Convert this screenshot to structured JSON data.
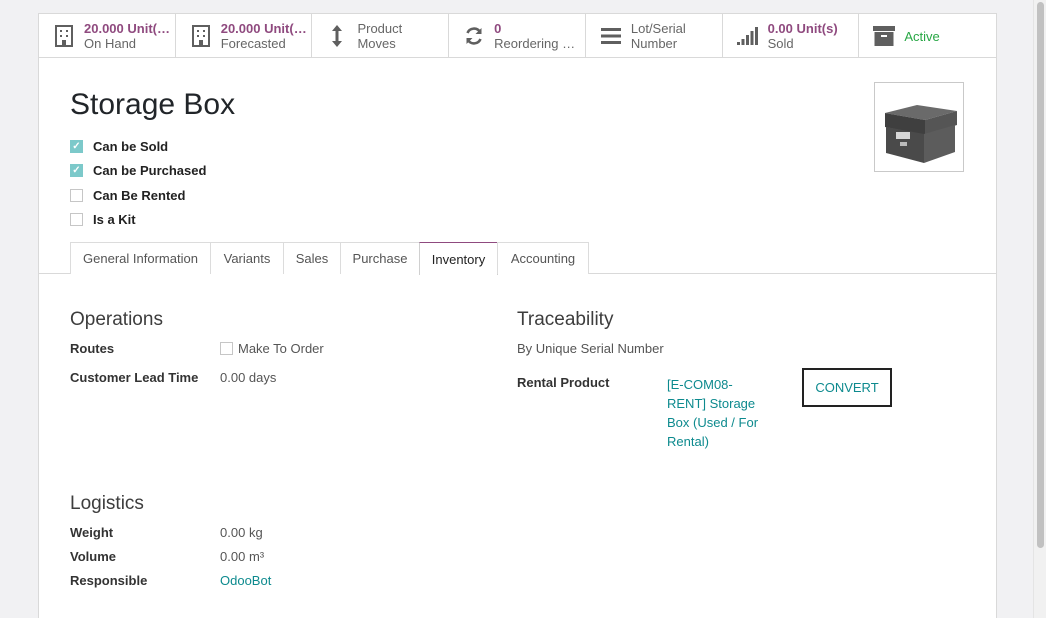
{
  "smart_buttons": [
    {
      "value": "20.000 Unit(…",
      "label": "On Hand",
      "icon": "building-icon"
    },
    {
      "value": "20.000 Unit(…",
      "label": "Forecasted",
      "icon": "building-icon"
    },
    {
      "value": "Product",
      "label": "Moves",
      "icon": "arrows-vertical-icon"
    },
    {
      "value": "0",
      "label": "Reordering …",
      "icon": "refresh-icon"
    },
    {
      "value": "Lot/Serial",
      "label": "Number",
      "icon": "bars-icon"
    },
    {
      "value": "0.00 Unit(s)",
      "label": "Sold",
      "icon": "signal-icon"
    },
    {
      "label": "Active",
      "icon": "archive-icon"
    }
  ],
  "product": {
    "name": "Storage Box",
    "checkboxes": [
      {
        "label": "Can be Sold",
        "checked": true
      },
      {
        "label": "Can be Purchased",
        "checked": true
      },
      {
        "label": "Can Be Rented",
        "checked": false
      },
      {
        "label": "Is a Kit",
        "checked": false
      }
    ]
  },
  "tabs": [
    "General Information",
    "Variants",
    "Sales",
    "Purchase",
    "Inventory",
    "Accounting"
  ],
  "active_tab": "Inventory",
  "operations": {
    "title": "Operations",
    "routes_label": "Routes",
    "route_option": "Make To Order",
    "lead_time_label": "Customer Lead Time",
    "lead_time_value": "0.00 days"
  },
  "traceability": {
    "title": "Traceability",
    "value": "By Unique Serial Number",
    "rental_label": "Rental Product",
    "rental_lines": [
      "[E-COM08-",
      "RENT] Storage",
      "Box (Used / For",
      "Rental)"
    ],
    "convert_label": "CONVERT"
  },
  "logistics": {
    "title": "Logistics",
    "weight_label": "Weight",
    "weight_value": "0.00",
    "weight_unit": "kg",
    "volume_label": "Volume",
    "volume_value": "0.00",
    "volume_unit": "m³",
    "responsible_label": "Responsible",
    "responsible_value": "OdooBot"
  },
  "colors": {
    "accent": "#8f4a7f",
    "link": "#0d8a8e",
    "active": "#28a745",
    "checkbox": "#7cc9ca"
  }
}
